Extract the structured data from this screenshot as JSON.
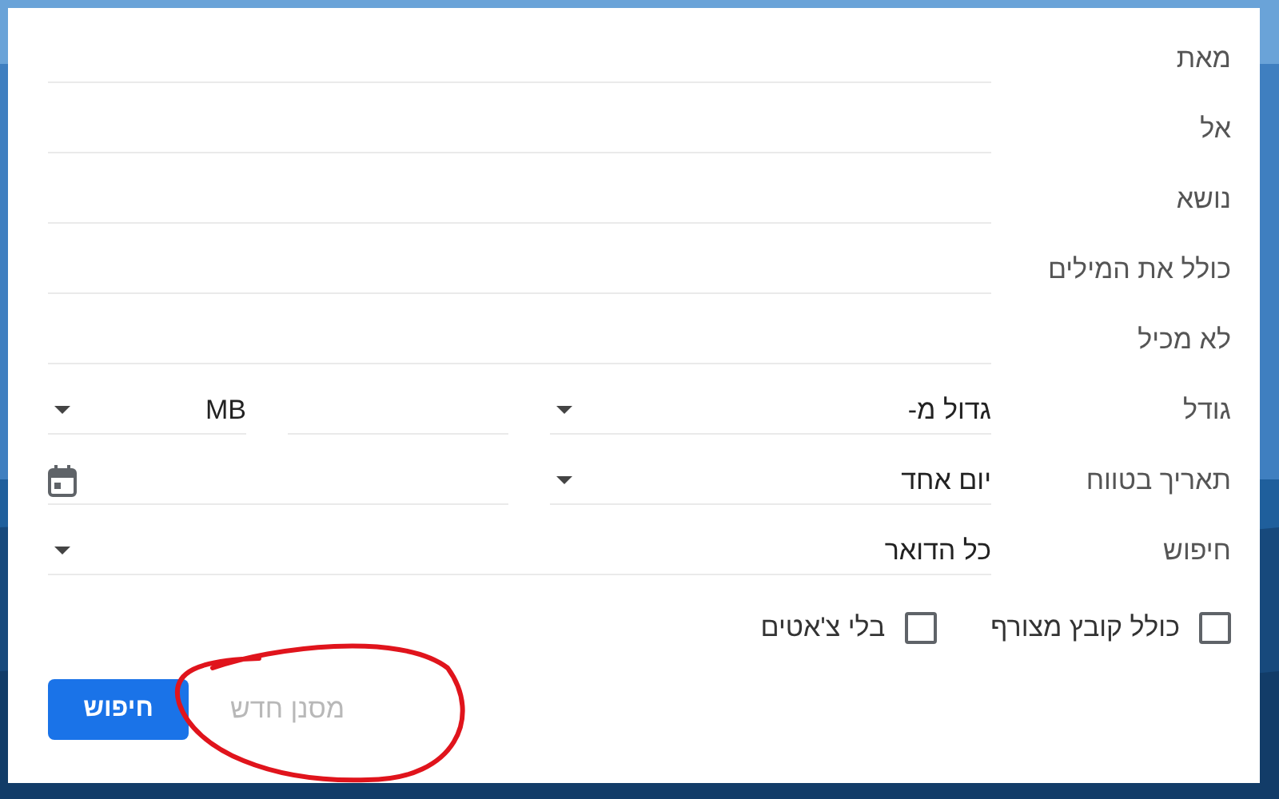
{
  "rows": [
    {
      "kind": "text",
      "label": "מאת"
    },
    {
      "kind": "text",
      "label": "אל"
    },
    {
      "kind": "text",
      "label": "נושא"
    },
    {
      "kind": "text",
      "label": "כולל את המילים"
    },
    {
      "kind": "text",
      "label": "לא מכיל"
    },
    {
      "kind": "size",
      "label": "גודל",
      "operator": "גדול מ-",
      "unit": "MB"
    },
    {
      "kind": "date",
      "label": "תאריך בטווח",
      "range": "יום אחד"
    },
    {
      "kind": "select",
      "label": "חיפוש",
      "value": "כל הדואר"
    }
  ],
  "checkboxes": [
    {
      "label": "כולל קובץ מצורף",
      "checked": false
    },
    {
      "label": "בלי צ'אטים",
      "checked": false
    }
  ],
  "search_button": "חיפוש",
  "new_filter": {
    "label": "מסנן חדש",
    "disabled": true
  }
}
